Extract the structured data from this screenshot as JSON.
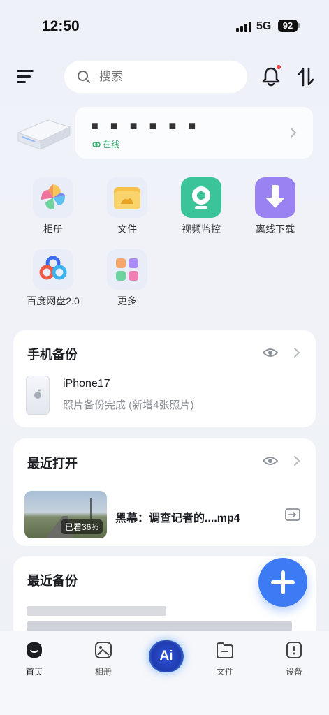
{
  "status_bar": {
    "time": "12:50",
    "network": "5G",
    "battery": "92"
  },
  "search": {
    "placeholder": "搜索"
  },
  "device": {
    "name": "■ ■ ■ ■ ■ ■",
    "status": "在线"
  },
  "grid": [
    {
      "label": "相册"
    },
    {
      "label": "文件"
    },
    {
      "label": "视频监控"
    },
    {
      "label": "离线下载"
    },
    {
      "label": "百度网盘2.0"
    },
    {
      "label": "更多"
    }
  ],
  "phone_backup": {
    "title": "手机备份",
    "device_name": "iPhone17",
    "subtitle": "照片备份完成 (新增4张照片)"
  },
  "recent_open": {
    "title": "最近打开",
    "file_name": "黑幕：调查记者的....mp4",
    "progress_label": "已看36%"
  },
  "recent_backup": {
    "title": "最近备份"
  },
  "tabbar": {
    "items": [
      {
        "label": "首页"
      },
      {
        "label": "相册"
      },
      {
        "label": "Ai"
      },
      {
        "label": "文件"
      },
      {
        "label": "设备"
      }
    ]
  },
  "colors": {
    "accent": "#3d7bf5",
    "online": "#2fa86a",
    "alert": "#f5413d"
  }
}
